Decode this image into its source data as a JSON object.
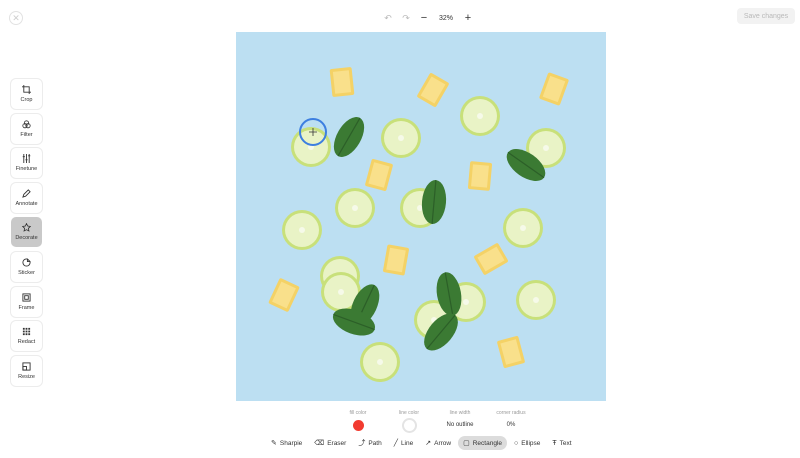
{
  "header": {
    "close_icon": "close-icon",
    "undo_icon": "undo-icon",
    "redo_icon": "redo-icon",
    "zoom_out_label": "−",
    "zoom_level": "32%",
    "zoom_in_label": "+",
    "save_label": "Save changes"
  },
  "sidebar": {
    "items": [
      {
        "label": "Crop",
        "icon": "crop-icon"
      },
      {
        "label": "Filter",
        "icon": "filter-icon"
      },
      {
        "label": "Finetune",
        "icon": "sliders-icon"
      },
      {
        "label": "Annotate",
        "icon": "pencil-icon"
      },
      {
        "label": "Decorate",
        "icon": "star-icon",
        "active": true
      },
      {
        "label": "Sticker",
        "icon": "sticker-icon"
      },
      {
        "label": "Frame",
        "icon": "frame-icon"
      },
      {
        "label": "Redact",
        "icon": "redact-icon"
      },
      {
        "label": "Resize",
        "icon": "resize-icon"
      }
    ]
  },
  "properties": {
    "fill_color_label": "fill color",
    "fill_color": "#f23b30",
    "line_color_label": "line color",
    "line_color": "#ffffff",
    "line_width_label": "line width",
    "line_width_value": "No outline",
    "corner_radius_label": "corner radius",
    "corner_radius_value": "0%"
  },
  "shapes": [
    {
      "label": "Sharpie",
      "icon": "sharpie-icon"
    },
    {
      "label": "Eraser",
      "icon": "eraser-icon"
    },
    {
      "label": "Path",
      "icon": "path-icon"
    },
    {
      "label": "Line",
      "icon": "line-icon"
    },
    {
      "label": "Arrow",
      "icon": "arrow-icon"
    },
    {
      "label": "Rectangle",
      "icon": "rectangle-icon",
      "active": true
    },
    {
      "label": "Ellipse",
      "icon": "ellipse-icon"
    },
    {
      "label": "Text",
      "icon": "text-icon"
    }
  ],
  "colors": {
    "canvas_bg": "#bcdff2",
    "cursor_ring": "#3d7fe0"
  }
}
